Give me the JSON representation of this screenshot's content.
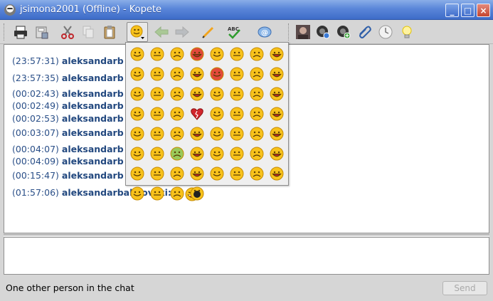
{
  "window": {
    "title": "jsimona2001 (Offline) - Kopete",
    "buttons": [
      "_",
      "□",
      "×"
    ]
  },
  "toolbar": {
    "left_tools": [
      "print-icon",
      "save-icon",
      "cut-icon",
      "copy-icon",
      "paste-icon",
      "smiley-icon",
      "back-arrow-icon",
      "forward-arrow-icon",
      "pen-icon",
      "spellcheck-icon",
      "nudge-icon"
    ],
    "spellcheck_text": "ABC",
    "right_tools": [
      "contact-photo",
      "contact-status-icon",
      "add-contact-icon",
      "file-send-icon",
      "history-icon",
      "lightbulb-icon"
    ]
  },
  "chat": {
    "messages": [
      {
        "time": "(23:57:31)",
        "nick": "aleksandarb"
      },
      {
        "time": "(23:57:35)",
        "nick": "aleksandarb"
      },
      {
        "time": "(00:02:43)",
        "nick": "aleksandarb"
      },
      {
        "time": "(00:02:49)",
        "nick": "aleksandarb"
      },
      {
        "time": "(00:02:53)",
        "nick": "aleksandarb"
      },
      {
        "time": "(00:03:07)",
        "nick": "aleksandarb"
      },
      {
        "time": "(00:04:07)",
        "nick": "aleksandarb"
      },
      {
        "time": "(00:04:09)",
        "nick": "aleksandarb"
      },
      {
        "time": "(00:15:47)",
        "nick": "aleksandarb"
      },
      {
        "time": "(01:57:06)",
        "nick": "aleksandarbalalovski:"
      }
    ]
  },
  "emoticons": {
    "count": 60,
    "columns": 8
  },
  "status": {
    "text": "One other person in the chat",
    "send_label": "Send"
  },
  "colors": {
    "title_bar": "#4f7bd3",
    "nick": "#22487f",
    "smiley_yellow": "#f7c21c"
  }
}
